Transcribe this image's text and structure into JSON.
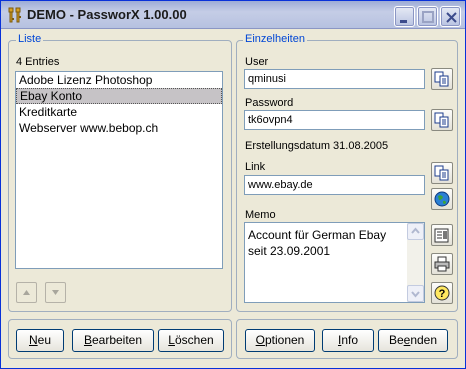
{
  "window": {
    "title": "DEMO - PassworX 1.00.00",
    "controls": {
      "minimize": "minimize-icon",
      "maximize": "maximize-icon",
      "close": "close-icon"
    }
  },
  "list_panel": {
    "legend": "Liste",
    "count_label": "4 Entries",
    "items": [
      {
        "label": "Adobe Lizenz Photoshop",
        "selected": false
      },
      {
        "label": "Ebay Konto",
        "selected": true
      },
      {
        "label": "Kreditkarte",
        "selected": false
      },
      {
        "label": "Webserver www.bebop.ch",
        "selected": false
      }
    ],
    "move_up_icon": "arrow-up-icon",
    "move_down_icon": "arrow-down-icon"
  },
  "details_panel": {
    "legend": "Einzelheiten",
    "user_label": "User",
    "user_value": "qminusi",
    "password_label": "Password",
    "password_value": "tk6ovpn4",
    "created_text": "Erstellungsdatum 31.08.2005",
    "link_label": "Link",
    "link_value": "www.ebay.de",
    "memo_label": "Memo",
    "memo_value": "Account für German Ebay seit 23.09.2001"
  },
  "list_buttons": [
    {
      "label": "Neu",
      "access": "N",
      "rest": "eu"
    },
    {
      "label": "Bearbeiten",
      "access": "B",
      "rest": "earbeiten"
    },
    {
      "label": "Löschen",
      "access": "L",
      "rest": "öschen"
    }
  ],
  "app_buttons": [
    {
      "label": "Optionen",
      "access": "O",
      "rest": "ptionen"
    },
    {
      "label": "Info",
      "access": "I",
      "rest": "nfo"
    },
    {
      "label": "Beenden",
      "pre": "Be",
      "access": "e",
      "rest": "nden"
    }
  ],
  "colors": {
    "accent": "#0046d5",
    "selection": "#c6c3c6",
    "field_border": "#7f9db9"
  }
}
